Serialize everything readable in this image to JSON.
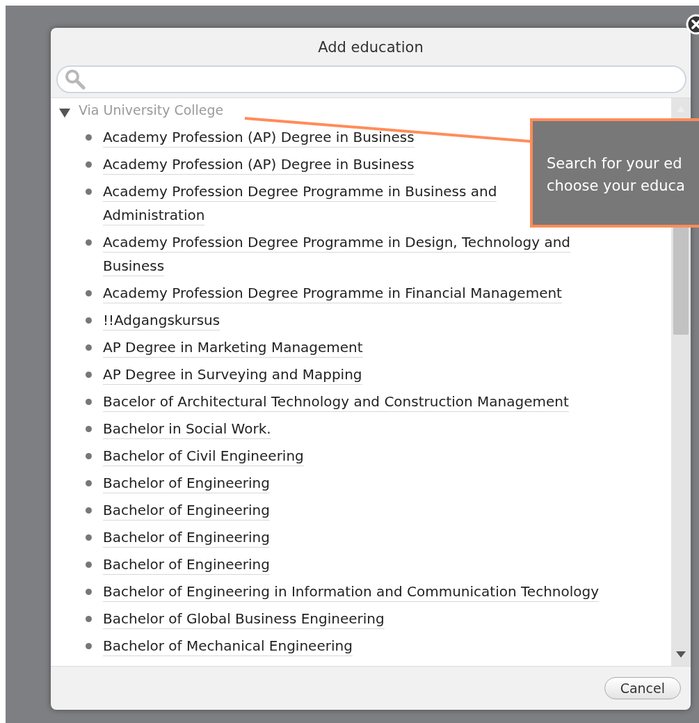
{
  "dialog": {
    "title": "Add education",
    "tree": {
      "label": "Via University College",
      "expanded": true,
      "children": [
        {
          "lines": [
            "Academy Profession (AP) Degree in Business"
          ]
        },
        {
          "lines": [
            "Academy Profession (AP) Degree in Business"
          ]
        },
        {
          "lines": [
            "Academy Profession Degree Programme in Business and",
            "Administration"
          ]
        },
        {
          "lines": [
            "Academy Profession Degree Programme in Design, Technology and",
            "Business"
          ]
        },
        {
          "lines": [
            "Academy Profession Degree Programme in Financial Management"
          ]
        },
        {
          "lines": [
            "!!Adgangskursus"
          ]
        },
        {
          "lines": [
            "AP Degree in Marketing Management"
          ]
        },
        {
          "lines": [
            "AP Degree in Surveying and Mapping"
          ]
        },
        {
          "lines": [
            "Bacelor of Architectural Technology and Construction Management"
          ]
        },
        {
          "lines": [
            "Bachelor in Social Work."
          ]
        },
        {
          "lines": [
            "Bachelor of Civil Engineering"
          ]
        },
        {
          "lines": [
            "Bachelor of Engineering"
          ]
        },
        {
          "lines": [
            "Bachelor of Engineering"
          ]
        },
        {
          "lines": [
            "Bachelor of Engineering"
          ]
        },
        {
          "lines": [
            "Bachelor of Engineering"
          ]
        },
        {
          "lines": [
            "Bachelor of Engineering in Information and Communication Technology"
          ]
        },
        {
          "lines": [
            "Bachelor of Global Business Engineering"
          ]
        },
        {
          "lines": [
            "Bachelor of Mechanical Engineering"
          ]
        }
      ]
    },
    "buttons": [
      "Cancel"
    ]
  },
  "tooltip": {
    "lines": [
      "Search for your ed",
      "choose your educa"
    ]
  }
}
